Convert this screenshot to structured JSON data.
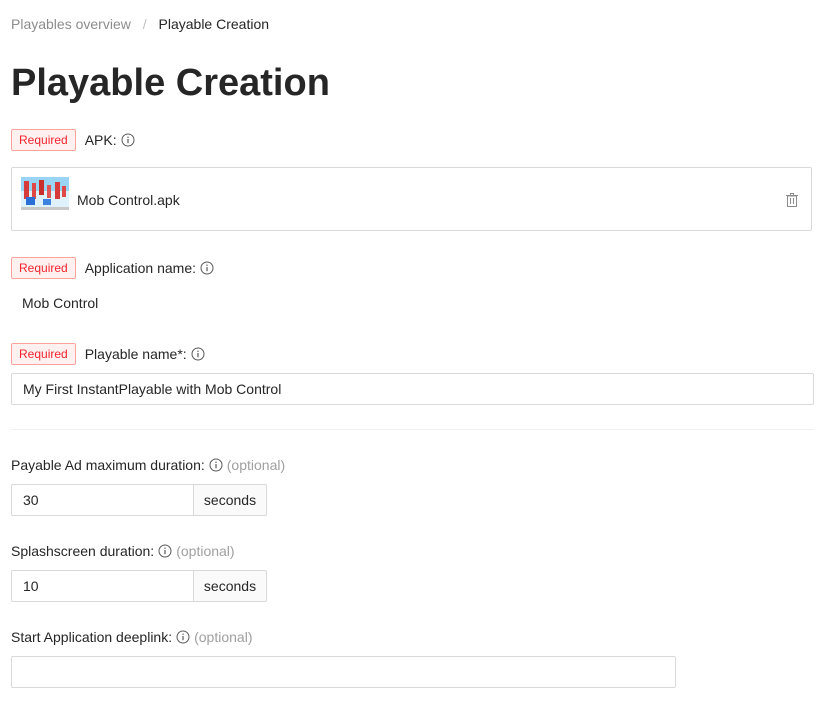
{
  "breadcrumb": {
    "parent": "Playables overview",
    "separator": "/",
    "current": "Playable Creation"
  },
  "page_title": "Playable Creation",
  "required_tag": "Required",
  "apk": {
    "label": "APK:",
    "file_name": "Mob Control.apk",
    "icons": {
      "info": "info-circle-icon",
      "delete": "trash-icon"
    }
  },
  "application_name": {
    "label": "Application name:",
    "value": "Mob Control"
  },
  "playable_name": {
    "label": "Playable name*:",
    "value": "My First InstantPlayable with Mob Control"
  },
  "max_duration": {
    "label": "Payable Ad maximum duration:",
    "optional": "(optional)",
    "value": "30",
    "unit": "seconds"
  },
  "splash_duration": {
    "label": "Splashscreen duration:",
    "optional": "(optional)",
    "value": "10",
    "unit": "seconds"
  },
  "deeplink": {
    "label": "Start Application deeplink:",
    "optional": "(optional)",
    "value": ""
  },
  "colors": {
    "required_text": "#f5222d",
    "required_bg": "#fff1f0",
    "required_border": "#ffa39e",
    "border": "#d9d9d9",
    "muted": "#8c8c8c"
  }
}
